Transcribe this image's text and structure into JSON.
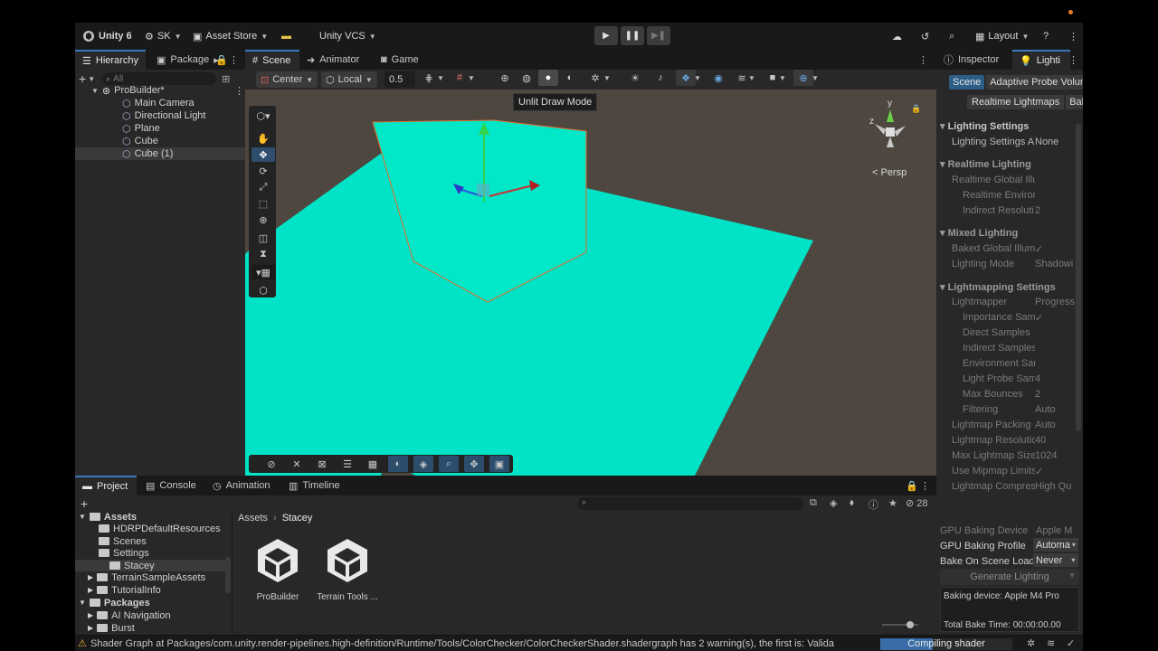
{
  "topbar": {
    "unity": "Unity 6",
    "account": "SK",
    "asset_store": "Asset Store",
    "vcs": "Unity VCS",
    "layout": "Layout"
  },
  "hierarchy": {
    "tab": "Hierarchy",
    "tab2": "Package",
    "search_placeholder": "All",
    "root": "ProBuilder*",
    "items": [
      "Main Camera",
      "Directional Light",
      "Plane",
      "Cube",
      "Cube (1)"
    ]
  },
  "scene": {
    "tabs": [
      "Scene",
      "Animator",
      "Game"
    ],
    "pivot": "Center",
    "space": "Local",
    "snap": "0.5",
    "tooltip": "Unlit Draw Mode",
    "persp": "< Persp",
    "gizmo_y": "y",
    "gizmo_z": "z",
    "colors": {
      "cyan": "#00e8c8",
      "floor": "#4d4740"
    }
  },
  "inspector": {
    "tabs": [
      "Inspector",
      "Lighti"
    ],
    "subtabs": [
      "Scene",
      "Adaptive Probe Volum"
    ],
    "subtabs2": [
      "Realtime Lightmaps",
      "Bak"
    ],
    "sections": {
      "lighting_settings": "Lighting Settings",
      "realtime": "Realtime Lighting",
      "mixed": "Mixed Lighting",
      "lightmapping": "Lightmapping Settings"
    },
    "rows": [
      {
        "label": "Lighting Settings A",
        "value": "None"
      },
      {
        "label": "Realtime Global Illu",
        "value": ""
      },
      {
        "label": "Realtime Enviror",
        "value": ""
      },
      {
        "label": "Indirect Resoluti",
        "value": "2"
      },
      {
        "label": "Baked Global Illum",
        "value": "✓"
      },
      {
        "label": "Lighting Mode",
        "value": "Shadowi"
      },
      {
        "label": "Lightmapper",
        "value": "Progress"
      },
      {
        "label": "Importance Sam",
        "value": "✓"
      },
      {
        "label": "Direct Samples",
        "value": ""
      },
      {
        "label": "Indirect Samples",
        "value": ""
      },
      {
        "label": "Environment Sar",
        "value": ""
      },
      {
        "label": "Light Probe Sam",
        "value": "4"
      },
      {
        "label": "Max Bounces",
        "value": "2"
      },
      {
        "label": "Filtering",
        "value": "Auto"
      },
      {
        "label": "Lightmap Packing",
        "value": "Auto"
      },
      {
        "label": "Lightmap Resolutio",
        "value": "40"
      },
      {
        "label": "Max Lightmap Size",
        "value": "1024"
      },
      {
        "label": "Use Mipmap Limits",
        "value": "✓"
      },
      {
        "label": "Lightmap Compres",
        "value": "High Qu"
      }
    ],
    "bottom": {
      "gpu_device_label": "GPU Baking Device",
      "gpu_device_value": "Apple M",
      "gpu_profile_label": "GPU Baking Profile",
      "gpu_profile_value": "Automa",
      "bake_on_load_label": "Bake On Scene Load",
      "bake_on_load_value": "Never",
      "generate_button": "Generate Lighting",
      "baking_device": "Baking device: Apple M4 Pro",
      "total_bake": "Total Bake Time: 00:00:00.00"
    }
  },
  "project": {
    "tabs": [
      "Project",
      "Console",
      "Animation",
      "Timeline"
    ],
    "badge": "28",
    "tree": {
      "assets": "Assets",
      "items": [
        "HDRPDefaultResources",
        "Scenes",
        "Settings",
        "Stacey",
        "TerrainSampleAssets",
        "TutorialInfo"
      ],
      "packages": "Packages",
      "pkg_items": [
        "AI Navigation",
        "Burst"
      ]
    },
    "breadcrumb": [
      "Assets",
      "Stacey"
    ],
    "files": [
      "ProBuilder",
      "Terrain Tools ..."
    ]
  },
  "statusbar": {
    "message": "Shader Graph at Packages/com.unity.render-pipelines.high-definition/Runtime/Tools/ColorChecker/ColorCheckerShader.shadergraph has 2 warning(s), the first is: Validatic",
    "progress_label": "Compiling shader",
    "progress": 0.4
  }
}
